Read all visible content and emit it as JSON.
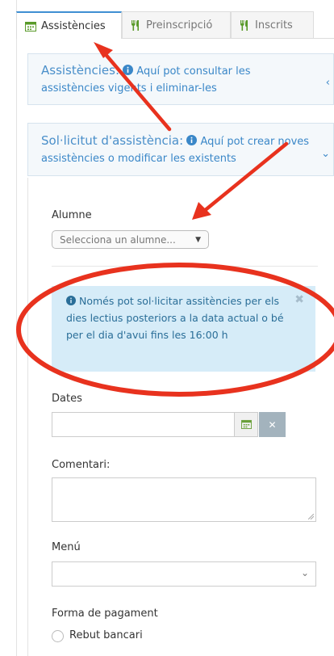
{
  "tabs": [
    {
      "label": "Assistències",
      "icon": "calendar-icon",
      "active": true
    },
    {
      "label": "Preinscripció",
      "icon": "cutlery-icon",
      "active": false
    },
    {
      "label": "Inscrits",
      "icon": "cutlery-icon",
      "active": false
    }
  ],
  "panel_assistencies": {
    "title": "Assistències:",
    "info": "Aquí pot consultar les assistències vigents i eliminar-les",
    "chevron": "‹"
  },
  "panel_solicitud": {
    "title": "Sol·licitut d'assistència:",
    "info": "Aquí pot crear noves assistències o modificar les existents",
    "chevron": "⌄"
  },
  "form": {
    "alumne_label": "Alumne",
    "alumne_placeholder": "Selecciona un alumne...",
    "alert_text": "Només pot sol·licitar assitències per els dies lectius posteriors a la data actual o bé per el dia d'avui fins les 16:00 h",
    "dates_label": "Dates",
    "comentari_label": "Comentari:",
    "menu_label": "Menú",
    "pagament_label": "Forma de pagament",
    "pagament_option": "Rebut bancari"
  },
  "colors": {
    "accent": "#3f8fd2",
    "alert_bg": "#d6ecf8",
    "annotation": "#e8321e"
  }
}
